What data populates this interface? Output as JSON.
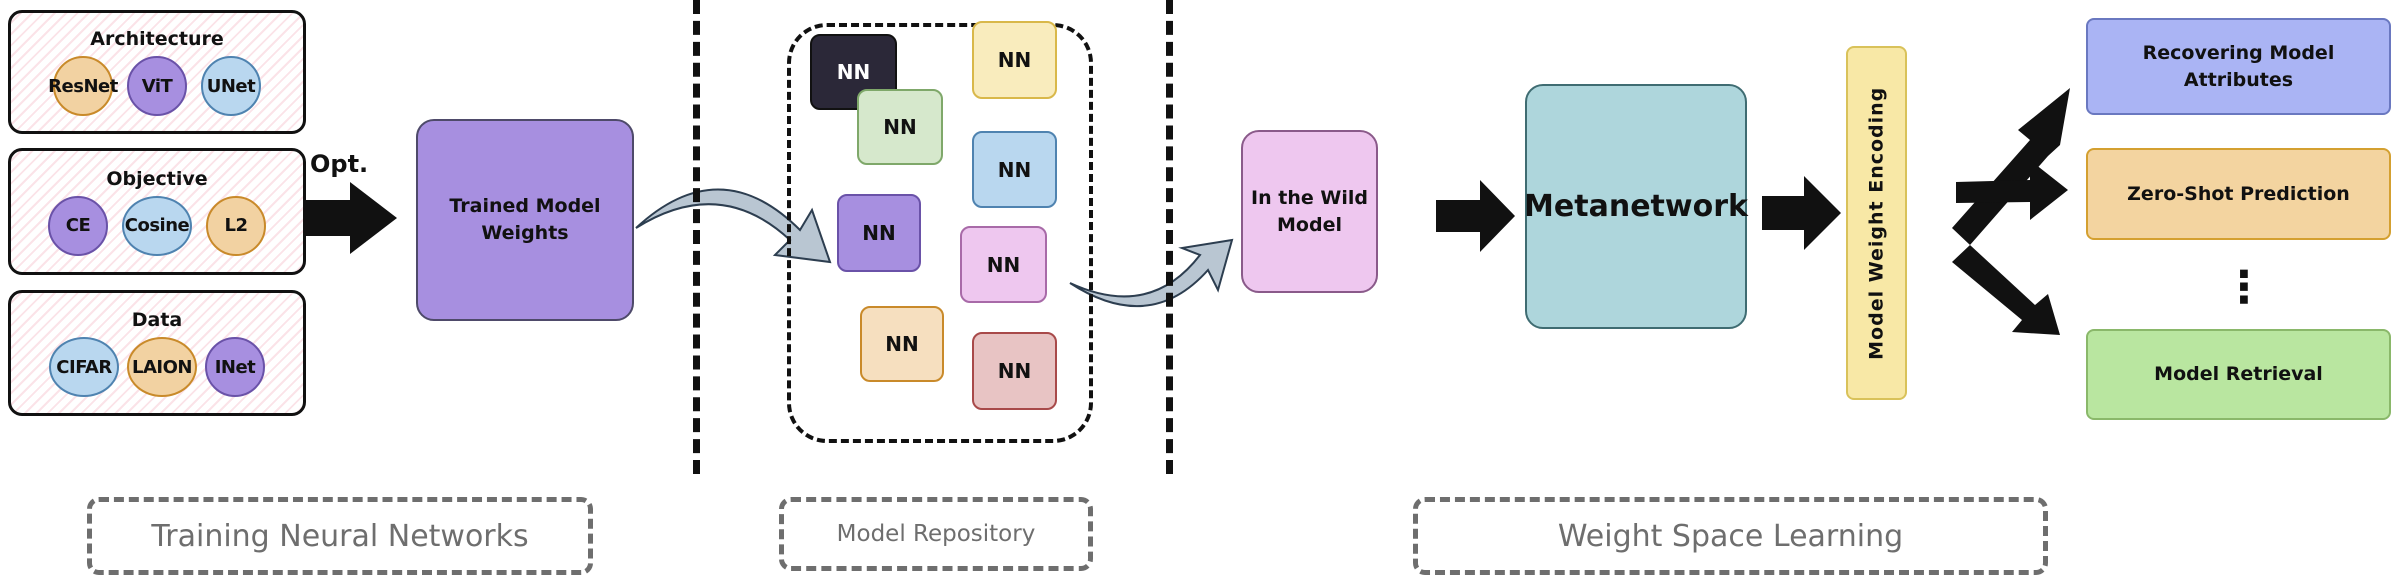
{
  "training": {
    "groups": [
      {
        "title": "Architecture",
        "items": [
          {
            "label": "ResNet",
            "color": "#f2d2a2",
            "border": "#c98a2a"
          },
          {
            "label": "ViT",
            "color": "#a78fe0",
            "border": "#6a52a8"
          },
          {
            "label": "UNet",
            "color": "#b9d7ef",
            "border": "#4f83b0"
          }
        ]
      },
      {
        "title": "Objective",
        "items": [
          {
            "label": "CE",
            "color": "#a78fe0",
            "border": "#6a52a8"
          },
          {
            "label": "Cosine",
            "color": "#b9d7ef",
            "border": "#4f83b0"
          },
          {
            "label": "L2",
            "color": "#f2d2a2",
            "border": "#c98a2a"
          }
        ]
      },
      {
        "title": "Data",
        "items": [
          {
            "label": "CIFAR",
            "color": "#b9d7ef",
            "border": "#4f83b0"
          },
          {
            "label": "LAION",
            "color": "#f2d2a2",
            "border": "#c98a2a"
          },
          {
            "label": "INet",
            "color": "#a78fe0",
            "border": "#6a52a8"
          }
        ]
      }
    ],
    "opt_label": "Opt.",
    "trained_box": "Trained Model Weights"
  },
  "repository": {
    "nn_label": "NN",
    "nn_colors": [
      "#2b2838",
      "#f9ecbd",
      "#d6e8cc",
      "#b9d7ef",
      "#a78fe0",
      "#eec7ef",
      "#f6dfbf",
      "#e8c4c4"
    ]
  },
  "weight_space": {
    "wild_box": "In the Wild Model",
    "metanetwork": "Metanetwork",
    "encoding": "Model Weight Encoding",
    "outputs": [
      {
        "label": "Recovering Model Attributes",
        "color": "#aab4f4"
      },
      {
        "label": "Zero-Shot Prediction",
        "color": "#f3d4a0"
      },
      {
        "label": "Model Retrieval",
        "color": "#b9e6a0"
      }
    ],
    "ellipsis": "⋮"
  },
  "section_labels": {
    "training": "Training Neural Networks",
    "repository": "Model Repository",
    "weight_space": "Weight Space Learning"
  }
}
